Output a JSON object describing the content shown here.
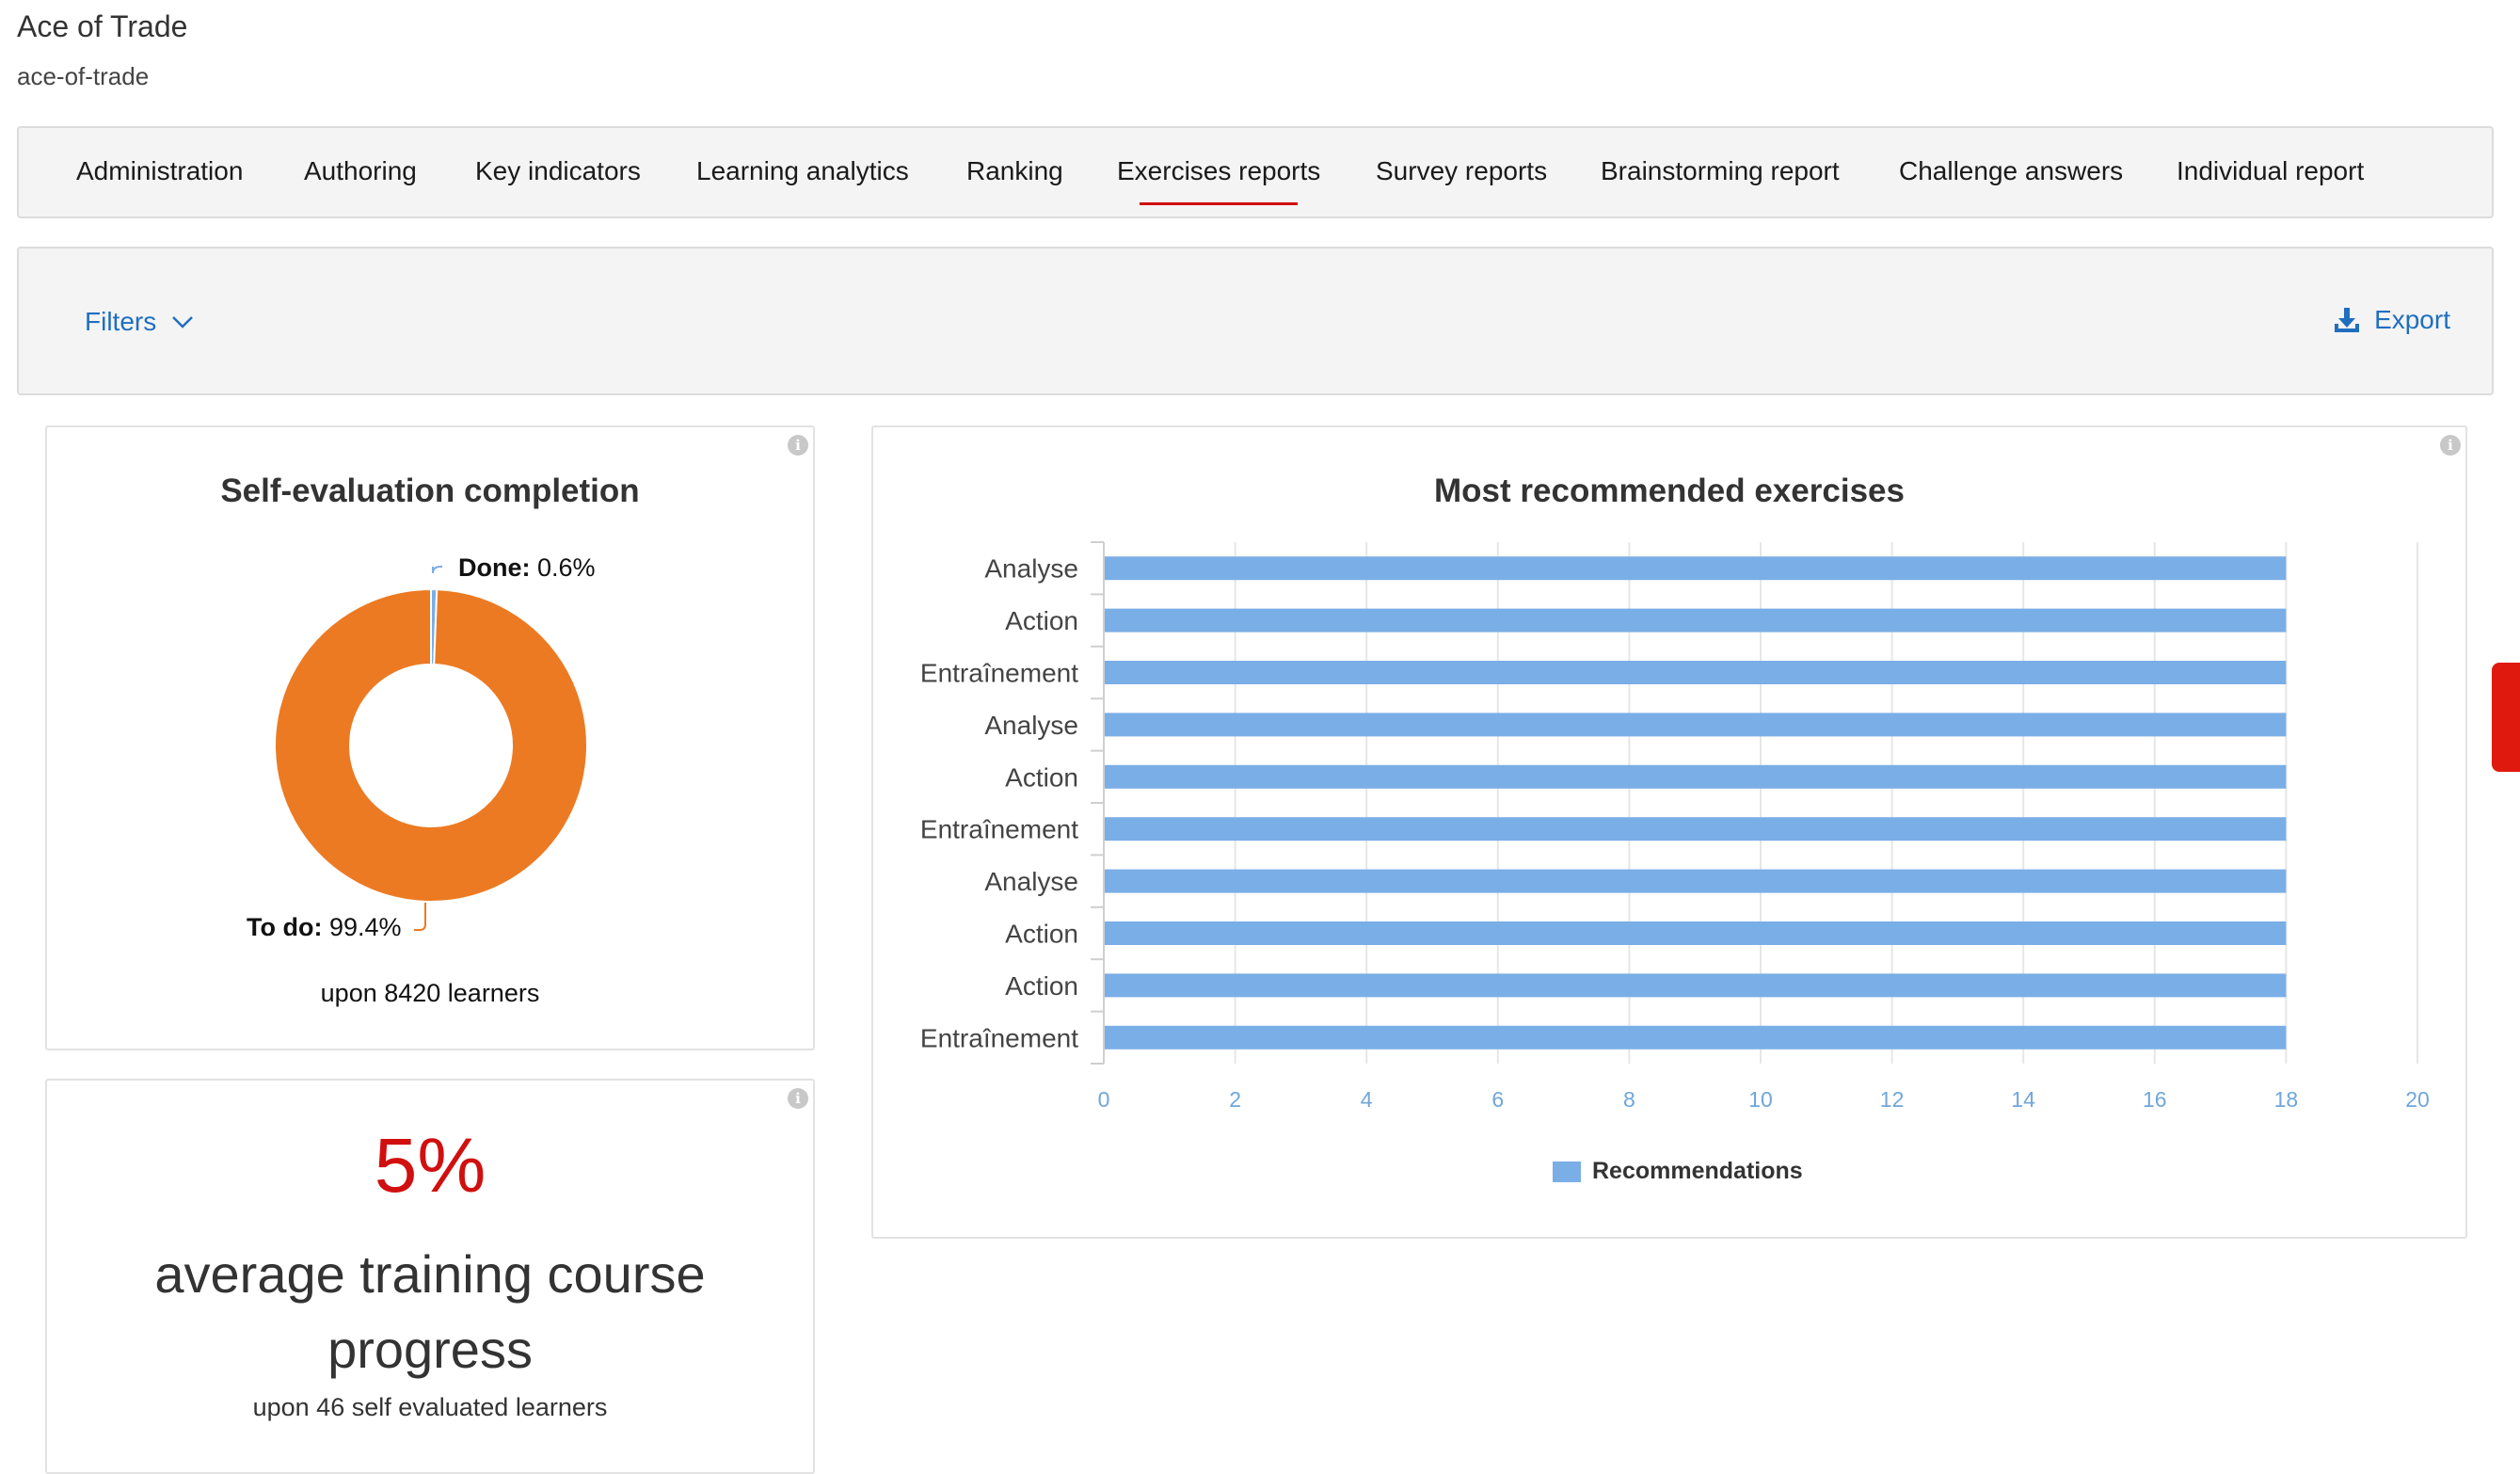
{
  "app": {
    "title": "Ace of Trade",
    "slug": "ace-of-trade"
  },
  "nav": {
    "tabs": [
      {
        "label": "Administration"
      },
      {
        "label": "Authoring"
      },
      {
        "label": "Key indicators"
      },
      {
        "label": "Learning analytics"
      },
      {
        "label": "Ranking"
      },
      {
        "label": "Exercises reports",
        "active": true
      },
      {
        "label": "Survey reports"
      },
      {
        "label": "Brainstorming report"
      },
      {
        "label": "Challenge answers"
      },
      {
        "label": "Individual report"
      }
    ]
  },
  "toolbar": {
    "filters_label": "Filters",
    "export_label": "Export"
  },
  "self_evaluation": {
    "title": "Self-evaluation completion",
    "done_label": "Done:",
    "done_value": "0.6%",
    "todo_label": "To do:",
    "todo_value": "99.4%",
    "learners_note": "upon 8420 learners",
    "info_icon": "info-icon"
  },
  "progress_card": {
    "value": "5%",
    "label": "average training course progress",
    "sub": "upon 46 self evaluated learners",
    "info_icon": "info-icon"
  },
  "recommended": {
    "title": "Most recommended exercises",
    "legend_label": "Recommendations",
    "info_icon": "info-icon"
  },
  "colors": {
    "accent_red": "#d10f0f",
    "link_blue": "#1f6fbf",
    "donut_todo": "#ec7a22",
    "donut_done": "#7aaee6",
    "bar": "#7aaee6"
  },
  "chart_data": [
    {
      "type": "pie",
      "title": "Self-evaluation completion",
      "labels": [
        "Done",
        "To do"
      ],
      "values": [
        0.6,
        99.4
      ]
    },
    {
      "type": "bar",
      "orientation": "horizontal",
      "title": "Most recommended exercises",
      "categories": [
        "Analyse",
        "Action",
        "Entraînement",
        "Analyse",
        "Action",
        "Entraînement",
        "Analyse",
        "Action",
        "Action",
        "Entraînement"
      ],
      "series": [
        {
          "name": "Recommendations",
          "values": [
            18,
            18,
            18,
            18,
            18,
            18,
            18,
            18,
            18,
            18
          ]
        }
      ],
      "xlim": [
        0,
        20
      ],
      "xticks": [
        "0",
        "2",
        "4",
        "6",
        "8",
        "10",
        "12",
        "14",
        "16",
        "18",
        "20"
      ],
      "grid": true,
      "legend": "bottom"
    }
  ]
}
